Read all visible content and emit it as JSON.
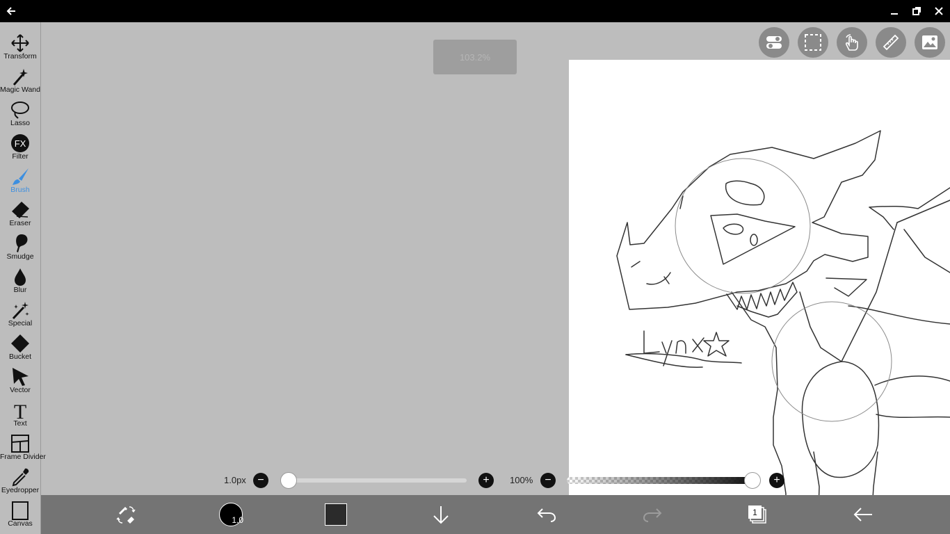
{
  "tools": [
    {
      "label": "Transform",
      "icon": "transform-icon",
      "active": false
    },
    {
      "label": "Magic Wand",
      "icon": "magic-wand-icon",
      "active": false
    },
    {
      "label": "Lasso",
      "icon": "lasso-icon",
      "active": false
    },
    {
      "label": "Filter",
      "icon": "filter-icon",
      "active": false
    },
    {
      "label": "Brush",
      "icon": "brush-icon",
      "active": true
    },
    {
      "label": "Eraser",
      "icon": "eraser-icon",
      "active": false
    },
    {
      "label": "Smudge",
      "icon": "smudge-icon",
      "active": false
    },
    {
      "label": "Blur",
      "icon": "blur-icon",
      "active": false
    },
    {
      "label": "Special",
      "icon": "special-icon",
      "active": false
    },
    {
      "label": "Bucket",
      "icon": "bucket-icon",
      "active": false
    },
    {
      "label": "Vector",
      "icon": "vector-icon",
      "active": false
    },
    {
      "label": "Text",
      "icon": "text-icon",
      "active": false
    },
    {
      "label": "Frame Divider",
      "icon": "frame-divider-icon",
      "active": false
    },
    {
      "label": "Eyedropper",
      "icon": "eyedropper-icon",
      "active": false
    },
    {
      "label": "Canvas",
      "icon": "canvas-icon",
      "active": false
    }
  ],
  "filter_icon_text": "FX",
  "text_icon_text": "T",
  "zoom_indicator": "103.2%",
  "brush_size": {
    "label": "1.0px",
    "value": 0.0
  },
  "opacity": {
    "label": "100%",
    "value": 1.0
  },
  "bottom": {
    "brush_size_badge": "1.0",
    "layer_count": "1",
    "color": "#2b2b2b"
  },
  "accent_color": "#3d8fe0"
}
